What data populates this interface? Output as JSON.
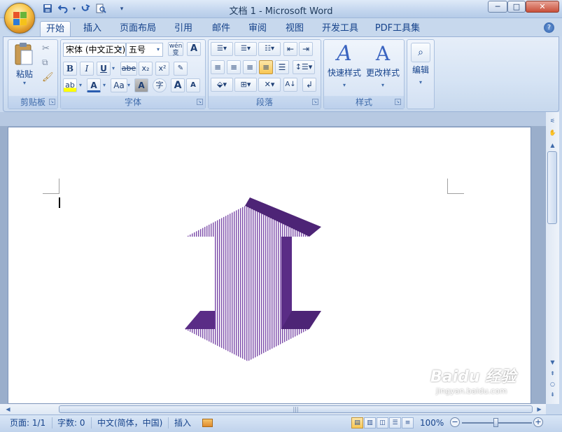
{
  "window": {
    "title": "文档 1 - Microsoft Word",
    "minimize": "─",
    "maximize": "□",
    "close": "✕"
  },
  "qat": {
    "save_icon": "save-icon",
    "undo_icon": "undo-icon",
    "redo_icon": "redo-icon",
    "preview_icon": "print-preview-icon"
  },
  "tabs": [
    {
      "label": "开始",
      "active": true
    },
    {
      "label": "插入"
    },
    {
      "label": "页面布局"
    },
    {
      "label": "引用"
    },
    {
      "label": "邮件"
    },
    {
      "label": "审阅"
    },
    {
      "label": "视图"
    },
    {
      "label": "开发工具"
    },
    {
      "label": "PDF工具集"
    }
  ],
  "ribbon": {
    "clipboard": {
      "label": "剪贴板",
      "paste": "粘贴"
    },
    "font": {
      "label": "字体",
      "font_name": "宋体 (中文正文)",
      "font_size": "五号",
      "phonetic": "wén",
      "bold": "B",
      "italic": "I",
      "underline": "U",
      "strike": "abe",
      "subscript": "x₂",
      "superscript": "x²",
      "highlight": "ab",
      "font_color": "A",
      "change_case": "Aa",
      "char_shading": "A",
      "enclose": "字",
      "grow": "A",
      "shrink": "A"
    },
    "paragraph": {
      "label": "段落"
    },
    "styles": {
      "label": "样式",
      "quick_styles": "快速样式",
      "change_styles": "更改样式"
    },
    "editing": {
      "label": "编辑"
    }
  },
  "status": {
    "page": "页面: 1/1",
    "words": "字数: 0",
    "language": "中文(简体，中国)",
    "mode": "插入",
    "zoom": "100%"
  },
  "watermark": {
    "brand": "Baidu 经验",
    "url": "jingyan.baidu.com"
  },
  "colors": {
    "arrow_dark": "#5a2c86",
    "arrow_stripe": "#7a4aa8",
    "ribbon_text": "#15428b",
    "doc_background": "#9aaecb"
  }
}
